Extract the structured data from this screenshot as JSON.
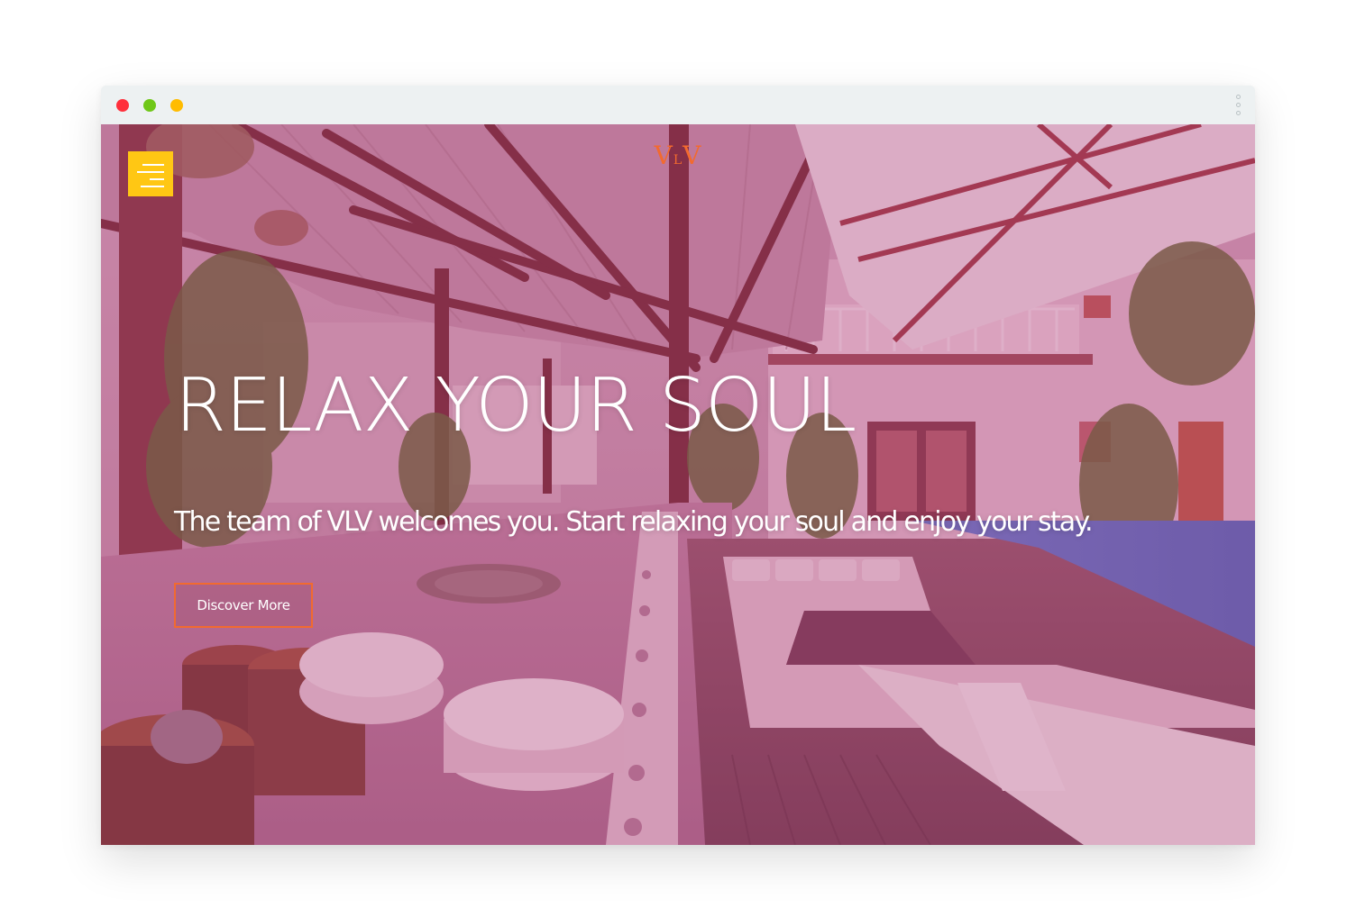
{
  "colors": {
    "traffic_red": "#ff2f3b",
    "traffic_green": "#6fc718",
    "traffic_yellow": "#ffbc00",
    "menu_button": "#ffc714",
    "accent": "#f26a2f"
  },
  "window_controls": {
    "close_icon": "red-dot",
    "minimize_icon": "green-dot",
    "maximize_icon": "yellow-dot",
    "more_icon": "vertical-dots"
  },
  "header": {
    "logo_left": "V",
    "logo_middle": "L",
    "logo_right": "V",
    "menu_icon": "hamburger-menu"
  },
  "hero": {
    "title": "RELAX YOUR SOUL",
    "subtitle": "The team of VLV welcomes you. Start relaxing your soul and enjoy your stay.",
    "cta_label": "Discover More",
    "background": "resort villa courtyard with pool, sunken lounge and wooden pergola"
  }
}
